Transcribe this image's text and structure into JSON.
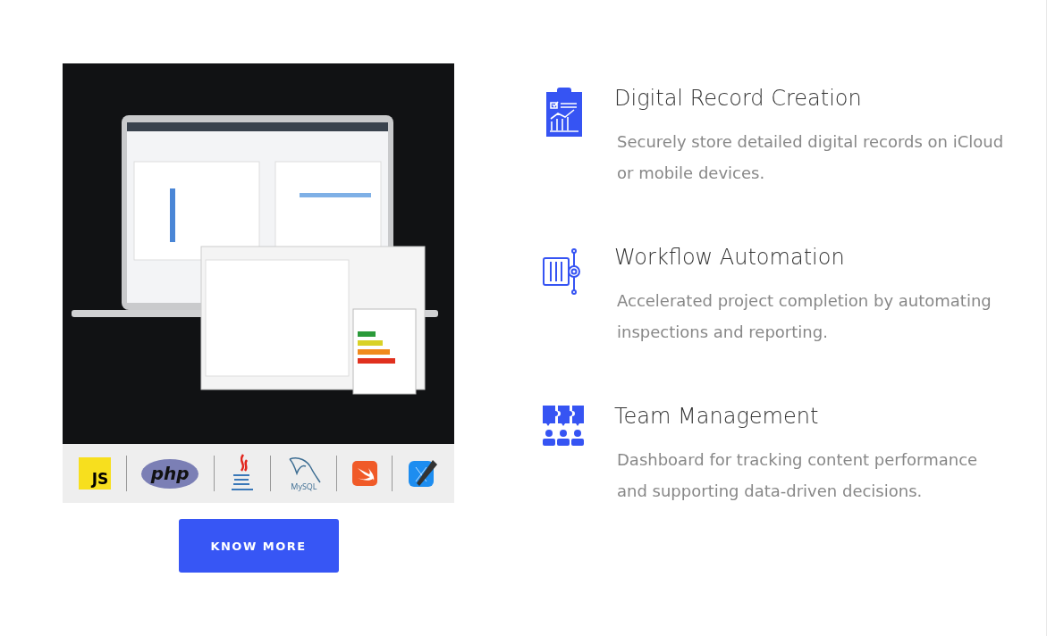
{
  "hero": {
    "logos": [
      {
        "kind": "js",
        "text": "JS"
      },
      {
        "kind": "php",
        "text": "php"
      },
      {
        "kind": "java"
      },
      {
        "kind": "mysql",
        "text": "MySQL"
      },
      {
        "kind": "swift"
      },
      {
        "kind": "xcode"
      }
    ],
    "button": "KNOW MORE"
  },
  "features": [
    {
      "kind": "clipboard",
      "title": "Digital Record Creation",
      "description": "Securely store detailed digital records on iCloud or mobile devices."
    },
    {
      "kind": "workflow",
      "title": "Workflow Automation",
      "description": "Accelerated project completion by automating inspections and reporting."
    },
    {
      "kind": "team",
      "title": "Team Management",
      "description": "Dashboard for tracking content performance and supporting data-driven decisions."
    }
  ]
}
